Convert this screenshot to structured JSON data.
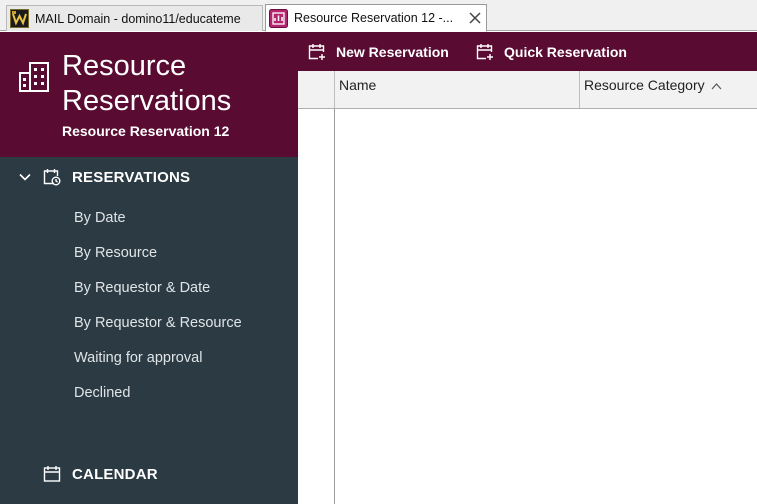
{
  "tabs": [
    {
      "label": "MAIL Domain - domino11/educateme",
      "active": false
    },
    {
      "label": "Resource Reservation 12 -...",
      "active": true
    }
  ],
  "app": {
    "title": "Resource Reservations",
    "subtitle": "Resource Reservation 12"
  },
  "sidebar": {
    "reservations_label": "RESERVATIONS",
    "items": [
      {
        "label": "By Date"
      },
      {
        "label": "By Resource"
      },
      {
        "label": "By Requestor & Date"
      },
      {
        "label": "By Requestor & Resource"
      },
      {
        "label": "Waiting for approval"
      },
      {
        "label": "Declined"
      }
    ],
    "calendar_label": "CALENDAR"
  },
  "toolbar": {
    "new_reservation_label": "New Reservation",
    "quick_reservation_label": "Quick Reservation"
  },
  "grid": {
    "columns": [
      {
        "label": "Name"
      },
      {
        "label": "Resource Category",
        "sorted": "ascending"
      }
    ],
    "rows": []
  },
  "colors": {
    "brand": "#5a0b31",
    "sidebar": "#2b3a43"
  }
}
